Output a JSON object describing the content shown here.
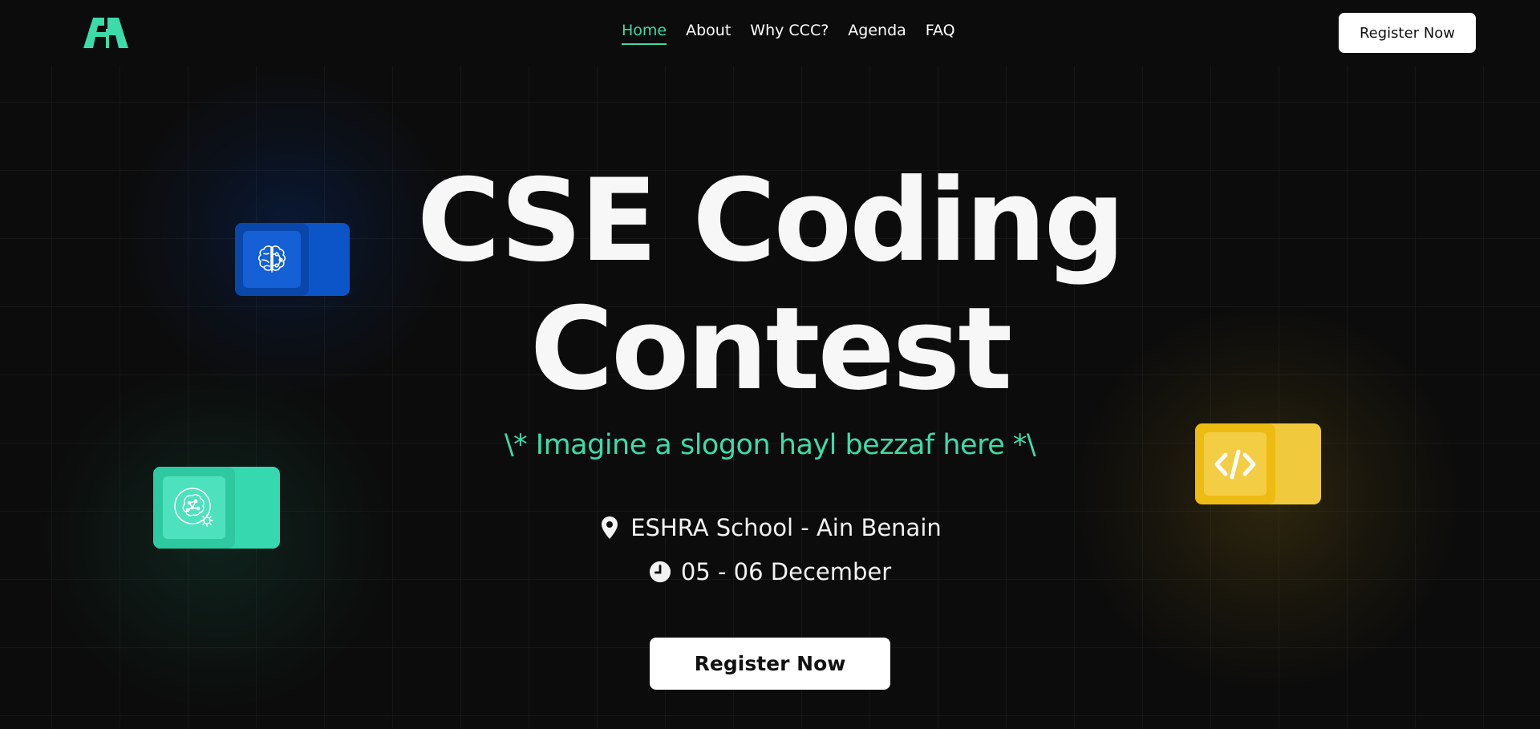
{
  "nav": {
    "links": [
      {
        "label": "Home",
        "active": true
      },
      {
        "label": "About",
        "active": false
      },
      {
        "label": "Why CCC?",
        "active": false
      },
      {
        "label": "Agenda",
        "active": false
      },
      {
        "label": "FAQ",
        "active": false
      }
    ],
    "register_label": "Register Now"
  },
  "hero": {
    "title_line1": "CSE Coding",
    "title_line2": "Contest",
    "slogan": "\\* Imagine a slogon hayl bezzaf here *\\",
    "location": "ESHRA School - Ain Benain",
    "date": "05 - 06 December",
    "register_label": "Register Now"
  },
  "icons": {
    "logo": "logo-icon",
    "location": "location-pin-icon",
    "date": "clock-icon",
    "blue_card": "brain-icon",
    "green_card": "ai-brain-gear-icon",
    "yellow_card": "code-icon"
  },
  "colors": {
    "accent": "#3ddba9",
    "background": "#0c0c0c",
    "blue_card": "#0c55c8",
    "green_card": "#36d8b0",
    "yellow_card": "#f1c93c"
  }
}
